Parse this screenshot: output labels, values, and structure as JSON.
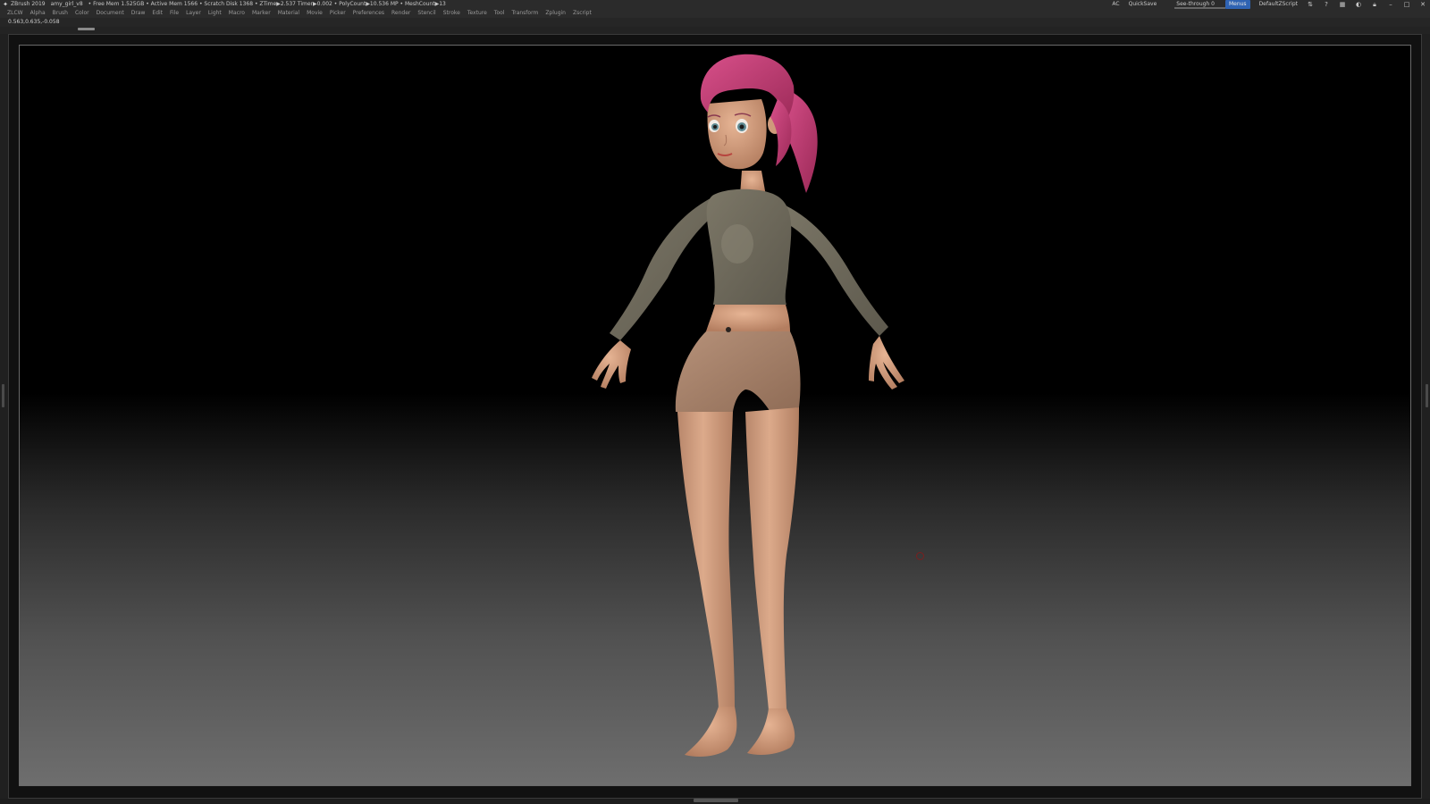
{
  "titlebar": {
    "app_name": "ZBrush 2019",
    "file_name": "amy_girl_v8",
    "stats": "• Free Mem 1.525GB • Active Mem 1566 • Scratch Disk 1368 • ZTime▶2.537 Timer▶0.002 • PolyCount▶10.536 MP • MeshCount▶13",
    "right": {
      "ac": "AC",
      "quicksave": "QuickSave",
      "see_through_label": "See-through 0",
      "see_through_value": 0,
      "menus": "Menus",
      "script": "DefaultZScript"
    },
    "icons": [
      "tray-icon",
      "help-icon",
      "layout-icon",
      "palette-icon",
      "lock-icon",
      "minimize-icon",
      "maximize-icon",
      "close-icon"
    ]
  },
  "menubar": {
    "items": [
      "ZLCW",
      "Alpha",
      "Brush",
      "Color",
      "Document",
      "Draw",
      "Edit",
      "File",
      "Layer",
      "Light",
      "Macro",
      "Marker",
      "Material",
      "Movie",
      "Picker",
      "Preferences",
      "Render",
      "Stencil",
      "Stroke",
      "Texture",
      "Tool",
      "Transform",
      "Zplugin",
      "Zscript"
    ]
  },
  "status": {
    "coords": "0.563,0.635,-0.058"
  },
  "colors": {
    "hair": "#c43b72",
    "top": "#6f6a5c",
    "shorts": "#a8836b",
    "skin": "#d9a585"
  }
}
